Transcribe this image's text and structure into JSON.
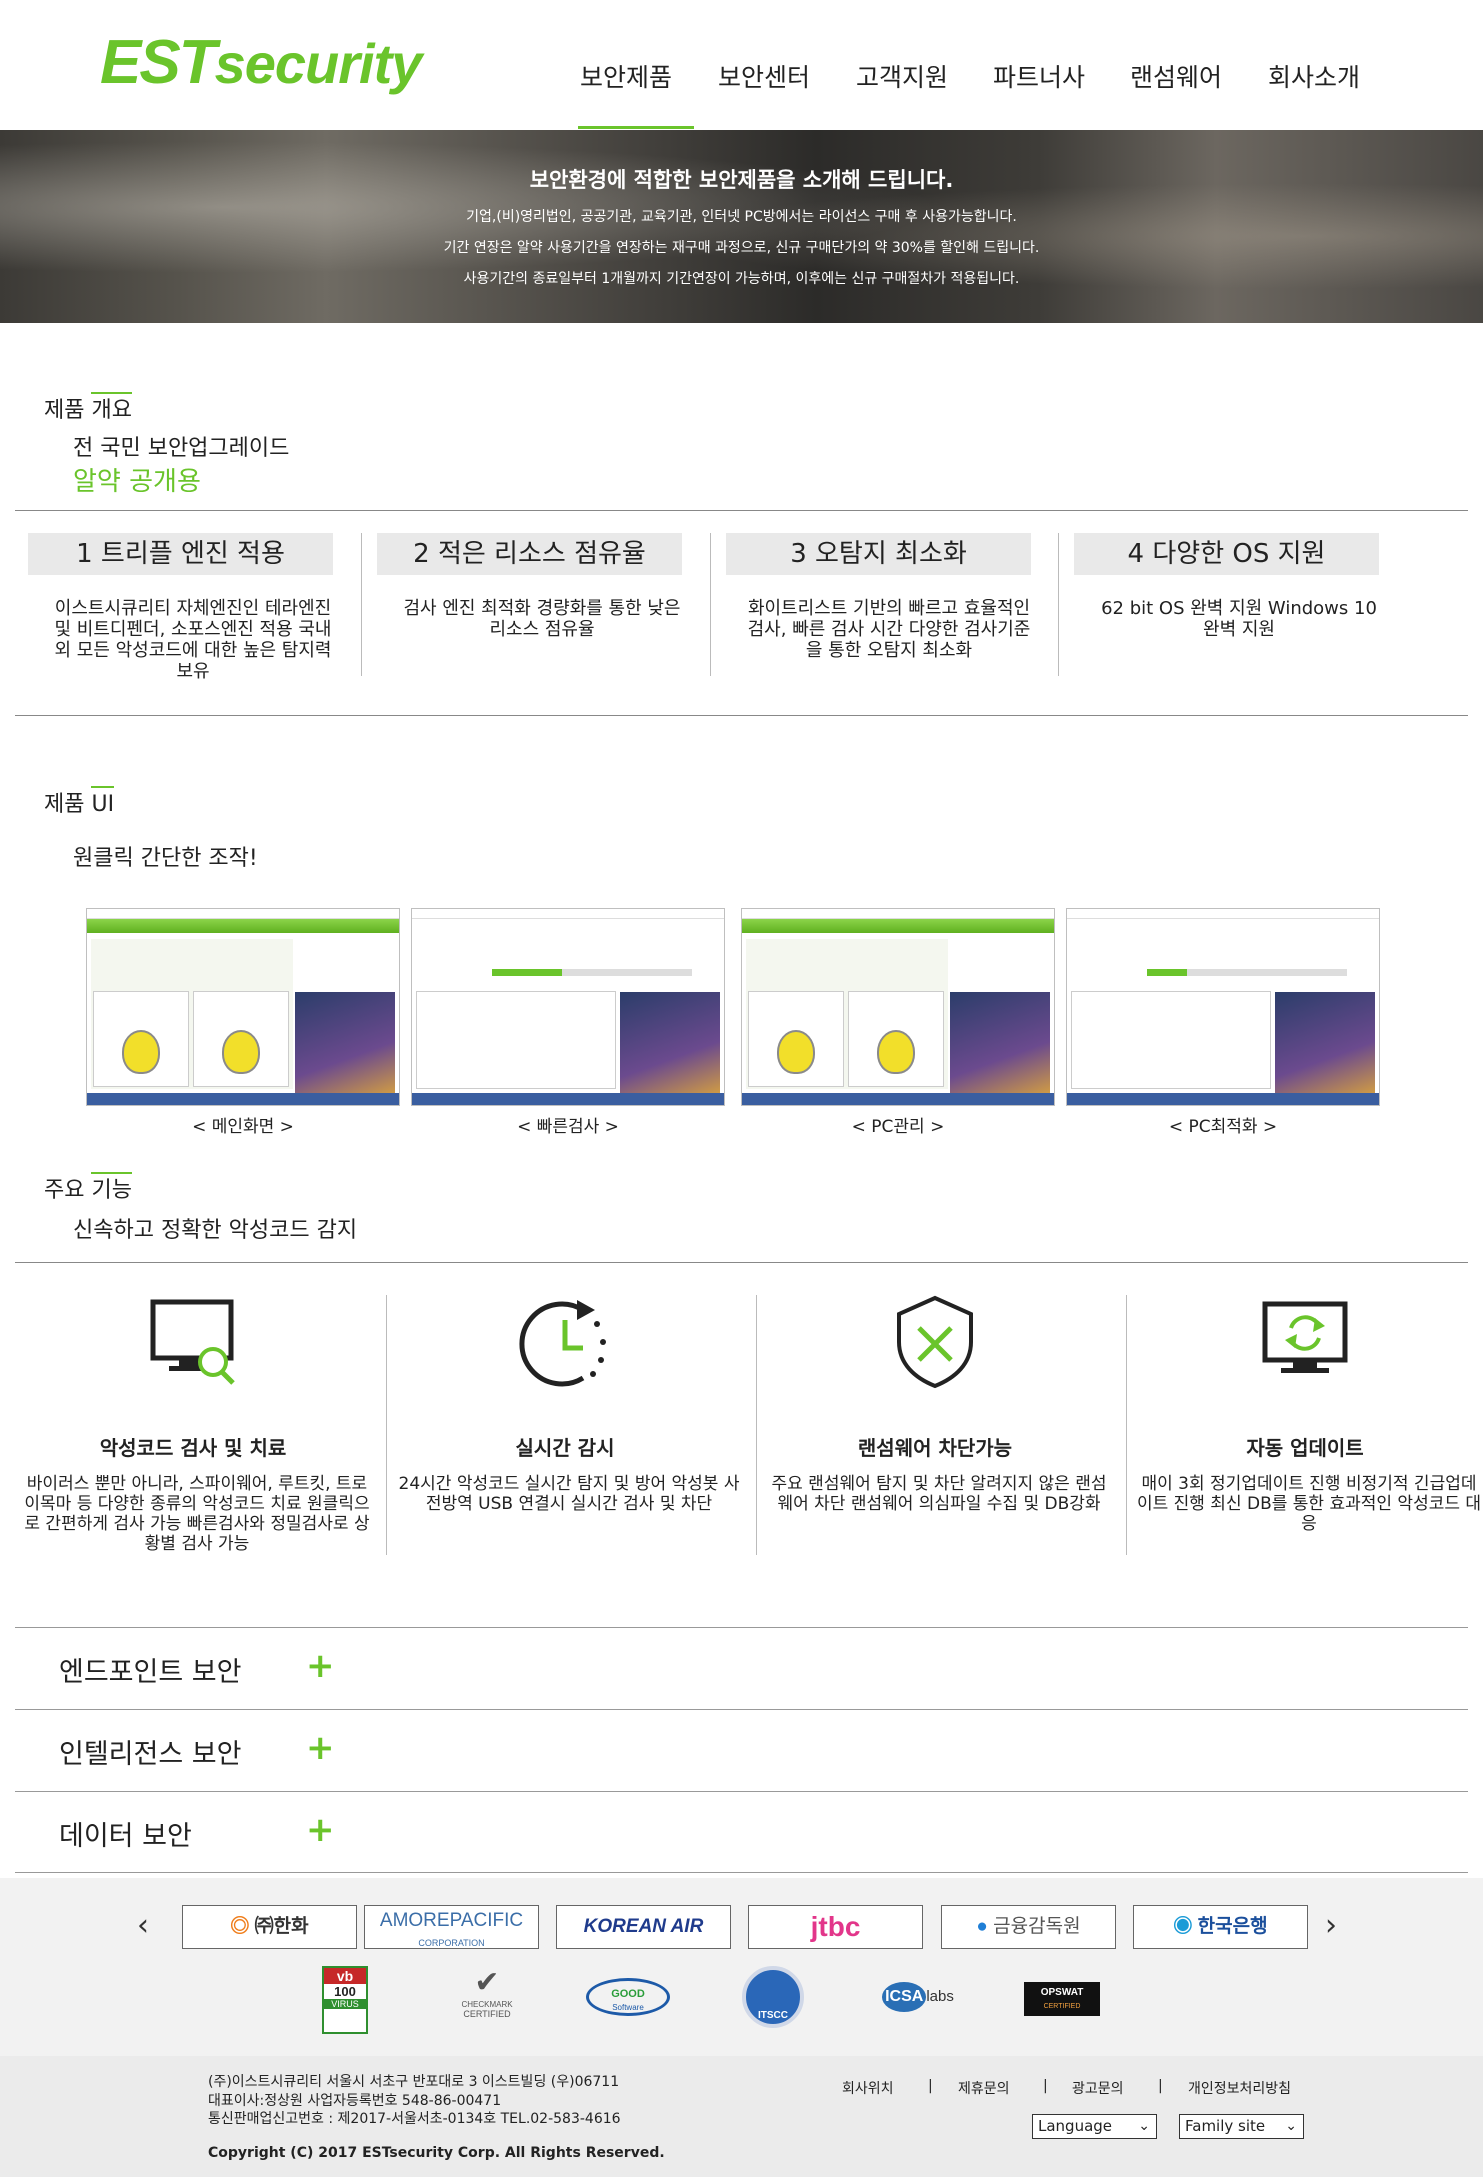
{
  "header": {
    "logo_main": "EST",
    "logo_sub": "security",
    "nav": [
      "보안제품",
      "보안센터",
      "고객지원",
      "파트너사",
      "랜섬웨어",
      "회사소개"
    ],
    "accent": "#6ac42b"
  },
  "hero": {
    "title": "보안환경에 적합한 보안제품을 소개해 드립니다.",
    "lines": [
      "기업,(비)영리법인, 공공기관, 교육기관, 인터넷 PC방에서는 라이선스 구매 후 사용가능합니다.",
      "기간 연장은 알약 사용기간을 연장하는 재구매 과정으로, 신규 구매단가의 약 30%를 할인해 드립니다.",
      "사용기간의 종료일부터 1개월까지 기간연장이 가능하며, 이후에는 신규 구매절차가 적용됩니다."
    ]
  },
  "overview": {
    "heading_a": "제품",
    "heading_b": "개요",
    "sub1": "전 국민 보안업그레이드",
    "sub2": "알약 공개용",
    "items": [
      {
        "title": "1 트리플 엔진 적용",
        "desc": "이스트시큐리티 자체엔진인 테라엔진 및 비트디펜더, 소포스엔진 적용 국내외 모든 악성코드에 대한 높은 탐지력 보유"
      },
      {
        "title": "2 적은 리소스 점유율",
        "desc": "검사 엔진 최적화 경량화를 통한 낮은 리소스 점유율"
      },
      {
        "title": "3 오탐지 최소화",
        "desc": "화이트리스트 기반의 빠르고 효율적인 검사, 빠른 검사 시간 다양한 검사기준을 통한 오탐지 최소화"
      },
      {
        "title": "4 다양한 OS 지원",
        "desc": "62 bit OS 완벽 지원 Windows 10 완벽 지원"
      }
    ]
  },
  "product_ui": {
    "heading_a": "제품",
    "heading_b": "UI",
    "sub": "원클릭 간단한 조작!",
    "shots": [
      {
        "caption": "< 메인화면 >"
      },
      {
        "caption": "< 빠른검사 >"
      },
      {
        "caption": "< PC관리 >"
      },
      {
        "caption": "< PC최적화 >"
      }
    ]
  },
  "features": {
    "heading_a": "주요",
    "heading_b": "기능",
    "sub": "신속하고 정확한 악성코드 감지",
    "items": [
      {
        "icon": "monitor-search-icon",
        "title": "악성코드 검사 및 치료",
        "desc": "바이러스 뿐만 아니라, 스파이웨어, 루트킷, 트로이목마 등 다양한 종류의 악성코드 치료 원클릭으로 간편하게 검사 가능 빠른검사와 정밀검사로 상황별 검사 가능"
      },
      {
        "icon": "clock-icon",
        "title": "실시간 감시",
        "desc": "24시간 악성코드 실시간 탐지 및 방어 악성봇 사전방역 USB 연결시 실시간 검사 및 차단"
      },
      {
        "icon": "shield-x-icon",
        "title": "랜섬웨어 차단가능",
        "desc": "주요 랜섬웨어 탐지 및 차단 알려지지 않은 랜섬웨어 차단 랜섬웨어 의심파일 수집 및 DB강화"
      },
      {
        "icon": "monitor-refresh-icon",
        "title": "자동 업데이트",
        "desc": "매이 3회 정기업데이트 진행 비정기적 긴급업데이트 진행 최신 DB를 통한 효과적인 악성코드 대응"
      }
    ]
  },
  "accordions": [
    {
      "label": "엔드포인트 보안"
    },
    {
      "label": "인텔리전스 보안"
    },
    {
      "label": "데이터 보안"
    }
  ],
  "partners": {
    "prev": "‹",
    "next": "›",
    "logos": [
      "㈜한화",
      "AMOREPACIFIC",
      "KOREAN AIR",
      "jtbc",
      "금융감독원",
      "한국은행"
    ],
    "amore_sub": "CORPORATION",
    "certs": [
      {
        "top": "vb",
        "mid": "100",
        "bot": "VIRUS"
      },
      {
        "top": "CHECKMARK",
        "bot": "CERTIFIED"
      },
      {
        "top": "GOOD",
        "bot": "Software"
      },
      {
        "top": "ITSCC"
      },
      {
        "top": "ICSA",
        "bot": "labs"
      },
      {
        "top": "OPSWAT",
        "bot": "CERTIFIED"
      }
    ]
  },
  "footer": {
    "address": "(주)이스트시큐리티 서울시 서초구 반포대로 3 이스트빌딩 (우)06711",
    "ceo": "대표이사:정상원 사업자등록번호 548-86-00471",
    "telecom": "통신판매업신고번호 : 제2017-서울서초-0134호 TEL.02-583-4616",
    "copyright": "Copyright (C) 2017 ESTsecurity Corp. All Rights Reserved.",
    "links": [
      "회사위치",
      "제휴문의",
      "광고문의",
      "개인정보처리방침"
    ],
    "language": "Language",
    "family_site": "Family site"
  }
}
